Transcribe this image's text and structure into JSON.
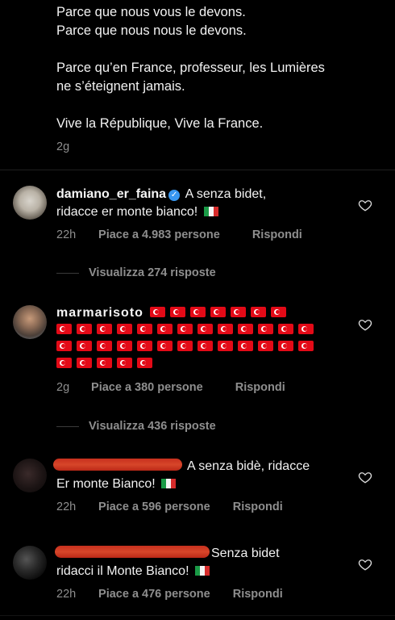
{
  "post": {
    "lines": [
      "Parce que nous vous le devons.",
      "Parce que nous nous le devons.",
      "",
      "Parce qu’en France, professeur, les Lumières",
      "ne s’éteignent jamais.",
      "",
      "Vive la République, Vive la France."
    ],
    "time": "2g"
  },
  "comments": [
    {
      "username": "damiano_er_faina",
      "verified": true,
      "text_line1": "A senza bidet,",
      "text_line2": "ridacce er monte bianco!",
      "flag": "italy-flag",
      "time": "22h",
      "likes": "Piace a 4.983 persone",
      "reply": "Rispondi",
      "replies": "Visualizza 274 risposte"
    },
    {
      "username": "marmarisoto",
      "verified": false,
      "flag": "turkey-flag",
      "flag_rows": [
        7,
        13,
        13,
        5
      ],
      "time": "2g",
      "likes": "Piace a 380 persone",
      "reply": "Rispondi",
      "replies": "Visualizza 436 risposte"
    },
    {
      "username": "",
      "redacted": true,
      "text_line1": "A senza bidè, ridacce",
      "text_line2": "Er monte Bianco!",
      "flag": "italy-flag",
      "time": "22h",
      "likes": "Piace a 596 persone",
      "reply": "Rispondi"
    },
    {
      "username": "",
      "redacted": true,
      "text_line1": "Senza bidet",
      "text_line2": "ridacci il Monte Bianco!",
      "flag": "italy-flag",
      "time": "22h",
      "likes": "Piace a 476 persone",
      "reply": "Rispondi"
    }
  ],
  "colors": {
    "background": "#000000",
    "text": "#f2f2f2",
    "muted": "#8e8e8e",
    "verified": "#3897f0",
    "redaction": "#d2321f"
  }
}
